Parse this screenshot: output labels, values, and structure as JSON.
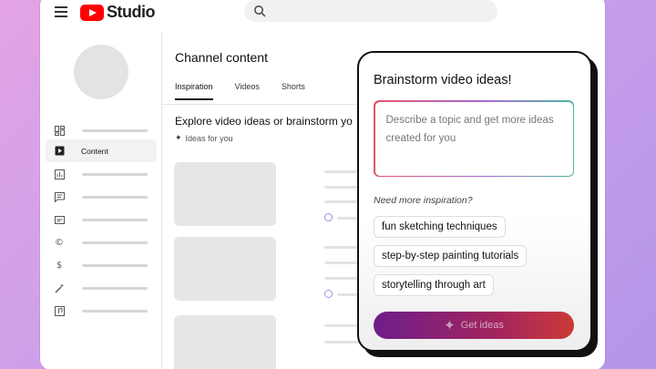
{
  "header": {
    "logo_text": "Studio",
    "search_placeholder": ""
  },
  "sidebar": {
    "items": [
      {
        "icon": "dashboard-icon",
        "label": ""
      },
      {
        "icon": "content-icon",
        "label": "Content",
        "active": true
      },
      {
        "icon": "analytics-icon",
        "label": ""
      },
      {
        "icon": "comments-icon",
        "label": ""
      },
      {
        "icon": "subtitles-icon",
        "label": ""
      },
      {
        "icon": "copyright-icon",
        "label": ""
      },
      {
        "icon": "earn-icon",
        "label": ""
      },
      {
        "icon": "customization-icon",
        "label": ""
      },
      {
        "icon": "audio-library-icon",
        "label": ""
      }
    ]
  },
  "main": {
    "title": "Channel content",
    "tabs": [
      {
        "label": "Inspiration",
        "active": true
      },
      {
        "label": "Videos",
        "active": false
      },
      {
        "label": "Shorts",
        "active": false
      }
    ],
    "section_title": "Explore video ideas or brainstorm yo",
    "ideas_label": "Ideas for you"
  },
  "brainstorm": {
    "title": "Brainstorm video ideas!",
    "prompt_placeholder": "Describe a topic and get more ideas created for you",
    "need_more_label": "Need more inspiration?",
    "suggestions": [
      "fun sketching techniques",
      "step-by-step painting tutorials",
      "storytelling through art"
    ],
    "button_label": "Get ideas"
  },
  "colors": {
    "accent_red": "#ff0000",
    "button_gradient_start": "#6e1e8a",
    "button_gradient_end": "#cc3a37",
    "background_gradient": "#d9a2e6"
  }
}
